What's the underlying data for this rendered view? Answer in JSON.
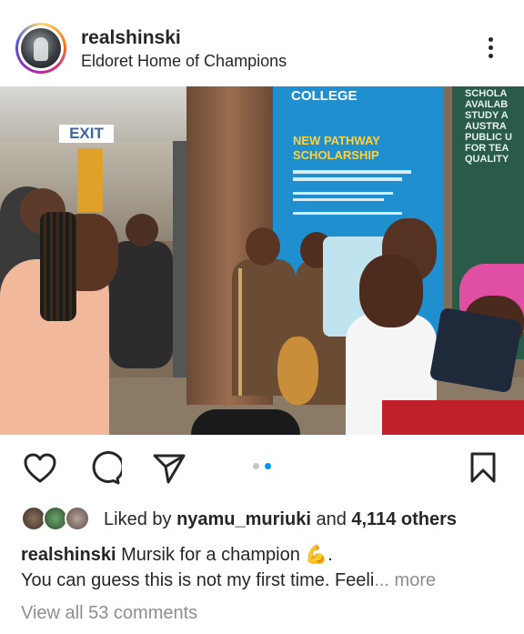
{
  "post": {
    "username": "realshinski",
    "location": "Eldoret Home of Champions",
    "carousel": {
      "total": 2,
      "current": 2
    }
  },
  "photo": {
    "exit_sign": "EXIT",
    "college_banner": "COLLEGE",
    "scholarship_title_1": "NEW PATHWAY",
    "scholarship_title_2": "SCHOLARSHIP",
    "right_banner": [
      "SCHOLA",
      "AVAILAB",
      "STUDY A",
      "AUSTRA",
      "PUBLIC U",
      "FOR TEA",
      "QUALITY"
    ]
  },
  "likes": {
    "prefix": "Liked by ",
    "user": "nyamu_muriuki",
    "connector": " and ",
    "others": "4,114 others"
  },
  "caption": {
    "username": "realshinski",
    "text": " Mursik for a champion ",
    "emoji": "💪",
    "end": ".",
    "line2": "You can guess this is not my first time. Feeli",
    "ellipsis": "...",
    "more": " more"
  },
  "comments_link": "View all 53 comments",
  "icons": [
    "heart-icon",
    "comment-icon",
    "share-icon",
    "bookmark-icon",
    "more-options-icon"
  ],
  "colors": {
    "text": "#262626",
    "muted": "#8e8e8e",
    "active_dot": "#0095f6",
    "inactive_dot": "#c7c7c7",
    "emoji": "#f5b400"
  }
}
